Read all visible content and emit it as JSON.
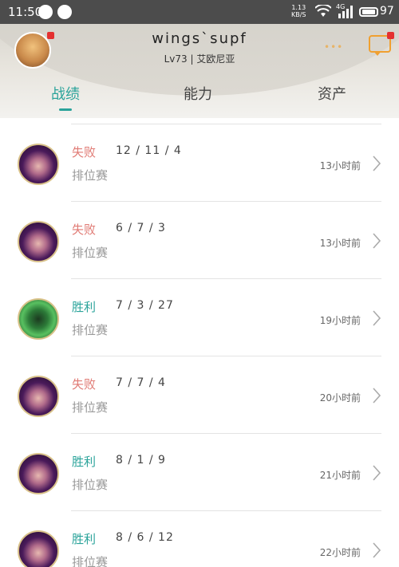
{
  "status_bar": {
    "time": "11:50",
    "speed_value": "1.13",
    "speed_unit": "KB/S",
    "network": "4G",
    "battery": "97"
  },
  "header": {
    "username": "wings`supf",
    "level_region": "Lv73 | 艾欧尼亚",
    "dots": "•••"
  },
  "tabs": [
    {
      "label": "战绩",
      "active": true
    },
    {
      "label": "能力",
      "active": false
    },
    {
      "label": "资产",
      "active": false
    }
  ],
  "matches": [
    {
      "result": "失败",
      "outcome": "lose",
      "kda": "12 / 11 / 4",
      "mode": "排位赛",
      "time": "13小时前",
      "champion_icon": "purple-champion-portrait"
    },
    {
      "result": "失败",
      "outcome": "lose",
      "kda": "6 / 7 / 3",
      "mode": "排位赛",
      "time": "13小时前",
      "champion_icon": "purple-champion-portrait"
    },
    {
      "result": "胜利",
      "outcome": "win",
      "kda": "7 / 3 / 27",
      "mode": "排位赛",
      "time": "19小时前",
      "champion_icon": "green-champion-portrait"
    },
    {
      "result": "失败",
      "outcome": "lose",
      "kda": "7 / 7 / 4",
      "mode": "排位赛",
      "time": "20小时前",
      "champion_icon": "purple-champion-portrait"
    },
    {
      "result": "胜利",
      "outcome": "win",
      "kda": "8 / 1 / 9",
      "mode": "排位赛",
      "time": "21小时前",
      "champion_icon": "purple-champion-portrait"
    },
    {
      "result": "胜利",
      "outcome": "win",
      "kda": "8 / 6 / 12",
      "mode": "排位赛",
      "time": "22小时前",
      "champion_icon": "purple-champion-portrait"
    }
  ],
  "colors": {
    "accent": "#2aa39a",
    "lose": "#e07a74",
    "notification": "#e43030"
  }
}
